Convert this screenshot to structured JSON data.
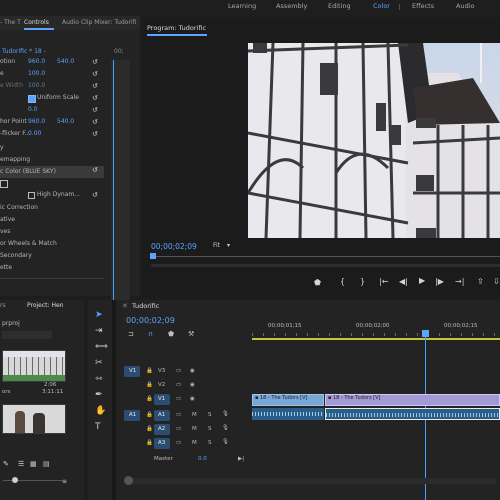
{
  "workspaces": {
    "items": [
      "Learning",
      "Assembly",
      "Editing",
      "Color",
      "Effects",
      "Audio"
    ],
    "active": "Color"
  },
  "effect_controls": {
    "tabs": [
      "- The T",
      "Controls",
      "Audio Clip Mixer: Tudorifi"
    ],
    "source_clip": "Tudorific * 18 -",
    "rows": [
      {
        "label": "otion",
        "v1": "960.0",
        "v2": "540.0"
      },
      {
        "label": "e",
        "v1": "100.0",
        "v2": ""
      },
      {
        "label": "e Width",
        "v1": "100.0",
        "v2": ""
      },
      {
        "label": "",
        "v1": "",
        "v2": "",
        "checkbox": "Uniform Scale"
      },
      {
        "label": "",
        "v1": "0.0",
        "v2": ""
      },
      {
        "label": "hor Point",
        "v1": "960.0",
        "v2": "540.0"
      },
      {
        "label": "-flicker F...",
        "v1": "0.00",
        "v2": ""
      },
      {
        "label": "y",
        "v1": "",
        "v2": ""
      },
      {
        "label": "emapping",
        "v1": "",
        "v2": ""
      },
      {
        "label": "c Color (BLUE SKY)",
        "v1": "",
        "v2": ""
      },
      {
        "label": "",
        "v1": "",
        "v2": "",
        "checkbox": "High Dynam..."
      },
      {
        "label": "ic Correction",
        "v1": "",
        "v2": ""
      },
      {
        "label": "ative",
        "v1": "",
        "v2": ""
      },
      {
        "label": "ves",
        "v1": "",
        "v2": ""
      },
      {
        "label": "or Wheels & Match",
        "v1": "",
        "v2": ""
      },
      {
        "label": "Secondary",
        "v1": "",
        "v2": ""
      },
      {
        "label": "ette",
        "v1": "",
        "v2": ""
      }
    ],
    "mini_timecode": "00;"
  },
  "program_monitor": {
    "title": "Program: Tudorific",
    "timecode": "00;00;02;09",
    "fit": "Fit"
  },
  "project": {
    "tabs": [
      "rs",
      "Project: Hen"
    ],
    "file": "prproj",
    "clips": [
      {
        "name": "",
        "duration": "2:06"
      },
      {
        "name": "ors",
        "duration": "3:11:11"
      }
    ]
  },
  "timeline": {
    "title": "Tudorific",
    "timecode": "00;00;02;09",
    "ruler": [
      "00;00;01;15",
      "00;00;02;00",
      "00;00;02;15"
    ],
    "tracks": {
      "video": [
        "V3",
        "V2",
        "V1"
      ],
      "audio": [
        "A1",
        "A2",
        "A3"
      ],
      "master": "Master",
      "master_val": "0.0"
    },
    "clips": {
      "v_left": "18 - The Tudors [V]",
      "v_right": "18 - The Tudors [V]"
    }
  }
}
